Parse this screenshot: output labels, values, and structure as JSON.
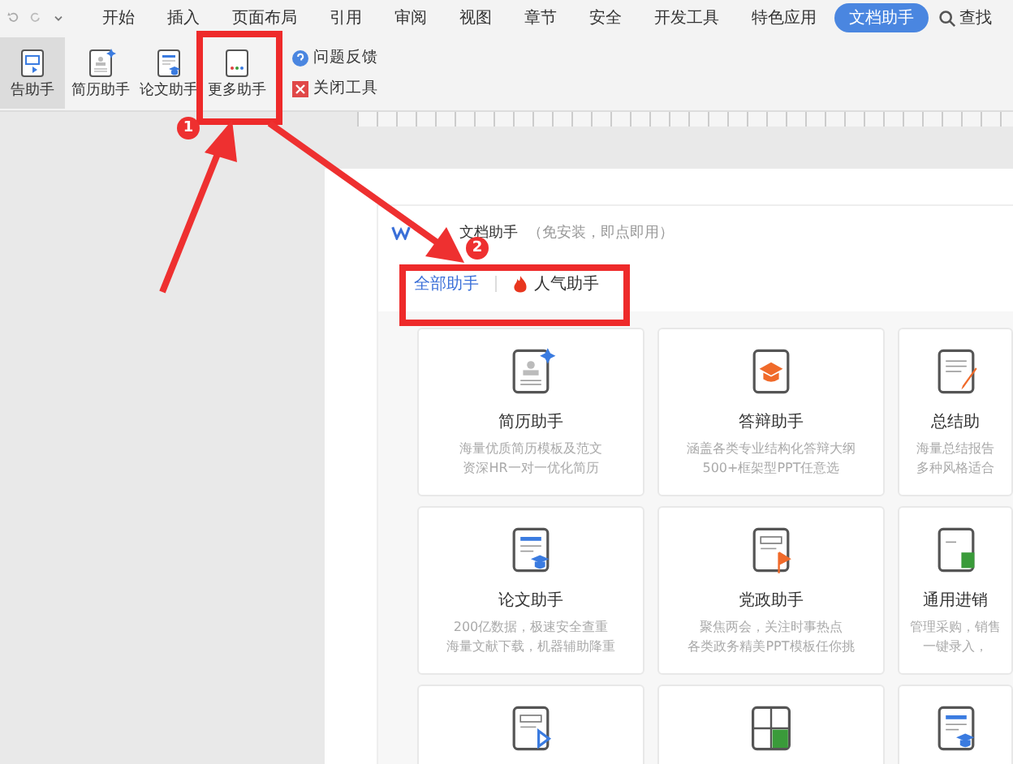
{
  "menu": [
    {
      "label": "开始",
      "selected": false
    },
    {
      "label": "插入",
      "selected": false
    },
    {
      "label": "页面布局",
      "selected": false
    },
    {
      "label": "引用",
      "selected": false
    },
    {
      "label": "审阅",
      "selected": false
    },
    {
      "label": "视图",
      "selected": false
    },
    {
      "label": "章节",
      "selected": false
    },
    {
      "label": "安全",
      "selected": false
    },
    {
      "label": "开发工具",
      "selected": false
    },
    {
      "label": "特色应用",
      "selected": false
    },
    {
      "label": "文档助手",
      "selected": true
    }
  ],
  "search": {
    "label": "查找"
  },
  "toolbar": [
    {
      "label": "告助手",
      "kind": "report",
      "selected": true
    },
    {
      "label": "简历助手",
      "kind": "resume",
      "selected": false
    },
    {
      "label": "论文助手",
      "kind": "thesis",
      "selected": false
    },
    {
      "label": "更多助手",
      "kind": "more",
      "selected": false
    }
  ],
  "side_links": [
    {
      "label": "问题反馈",
      "kind": "help"
    },
    {
      "label": "关闭工具",
      "kind": "close"
    }
  ],
  "markers": [
    "1",
    "2"
  ],
  "panel": {
    "title": "文档助手",
    "subtitle": "（免安装，即点即用）",
    "tabs": [
      {
        "label": "全部助手",
        "selected": true,
        "hot": false
      },
      {
        "label": "人气助手",
        "selected": false,
        "hot": true
      }
    ],
    "cards": [
      {
        "title": "简历助手",
        "kind": "resume",
        "desc": [
          "海量优质简历模板及范文",
          "资深HR一对一优化简历"
        ]
      },
      {
        "title": "答辩助手",
        "kind": "defense",
        "desc": [
          "涵盖各类专业结构化答辩大纲",
          "500+框架型PPT任意选"
        ]
      },
      {
        "title": "总结助",
        "kind": "summary",
        "desc": [
          "海量总结报告",
          "多种风格适合"
        ]
      },
      {
        "title": "论文助手",
        "kind": "thesis",
        "desc": [
          "200亿数据，极速安全查重",
          "海量文献下载，机器辅助降重"
        ]
      },
      {
        "title": "党政助手",
        "kind": "party",
        "desc": [
          "聚焦两会，关注时事热点",
          "各类政务精美PPT模板任你挑"
        ]
      },
      {
        "title": "通用进销",
        "kind": "invoice",
        "desc": [
          "管理采购，销售",
          "一键录入，"
        ]
      },
      {
        "kind": "video"
      },
      {
        "kind": "calculator"
      },
      {
        "kind": "cloud"
      }
    ]
  }
}
